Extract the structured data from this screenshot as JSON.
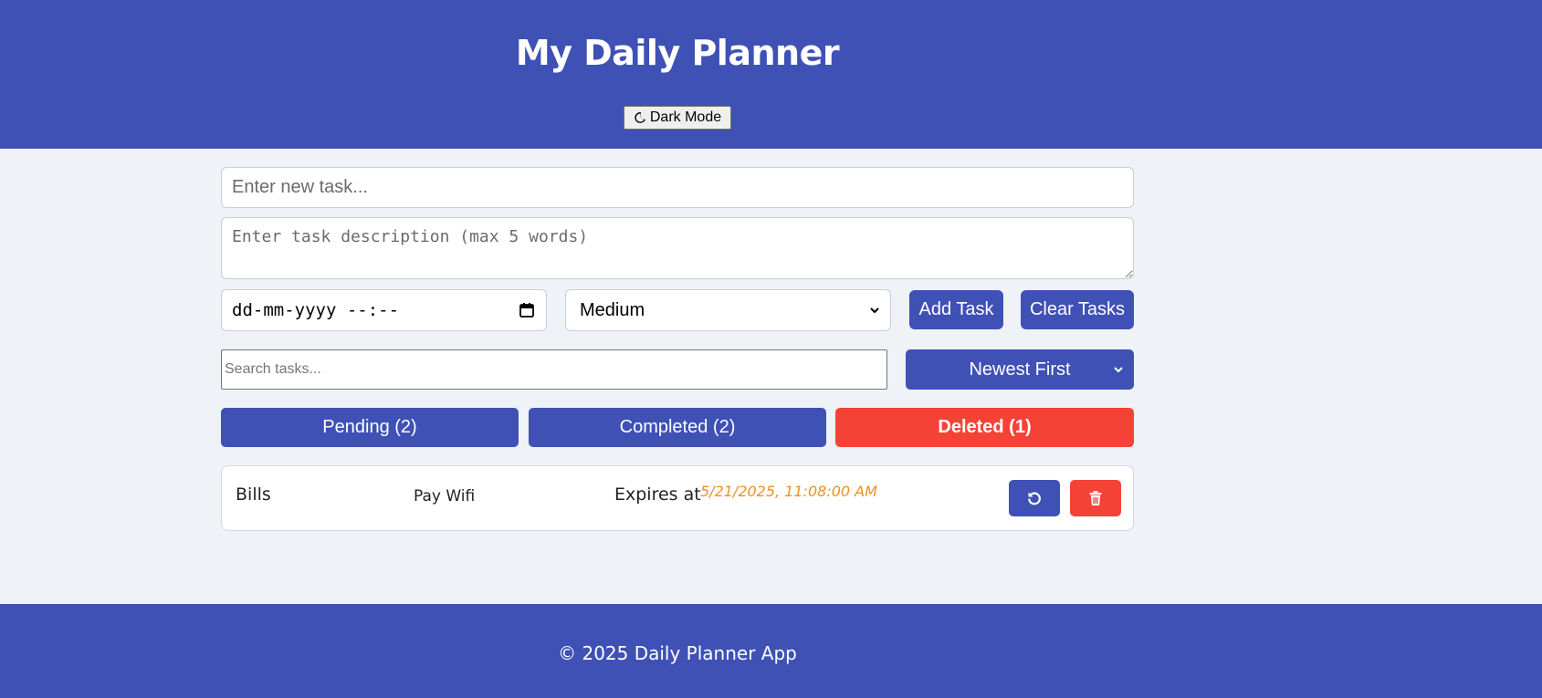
{
  "header": {
    "title": "My Daily Planner",
    "dark_mode_label": "Dark Mode",
    "dark_mode_icon": "moon-icon"
  },
  "form": {
    "task_placeholder": "Enter new task...",
    "description_placeholder": "Enter task description (max 5 words)",
    "date_value": "dd-mm-yyyy --:--",
    "priority_value": "Medium",
    "add_label": "Add Task",
    "clear_label": "Clear Tasks"
  },
  "filters": {
    "search_placeholder": "Search tasks...",
    "sort_value": "Newest First"
  },
  "tabs": [
    {
      "label": "Pending (2)",
      "active": false
    },
    {
      "label": "Completed (2)",
      "active": false
    },
    {
      "label": "Deleted (1)",
      "active": true
    }
  ],
  "tasks": [
    {
      "title": "Bills",
      "description": "Pay Wifi",
      "expires_label": "Expires at",
      "expires_at": "5/21/2025, 11:08:00 AM",
      "actions": [
        "restore-icon",
        "trash-icon"
      ]
    }
  ],
  "footer": {
    "text": "© 2025 Daily Planner App"
  },
  "colors": {
    "primary": "#3f51b5",
    "danger": "#f44336",
    "background": "#eff2f7",
    "expiry": "#ef8f1e"
  }
}
